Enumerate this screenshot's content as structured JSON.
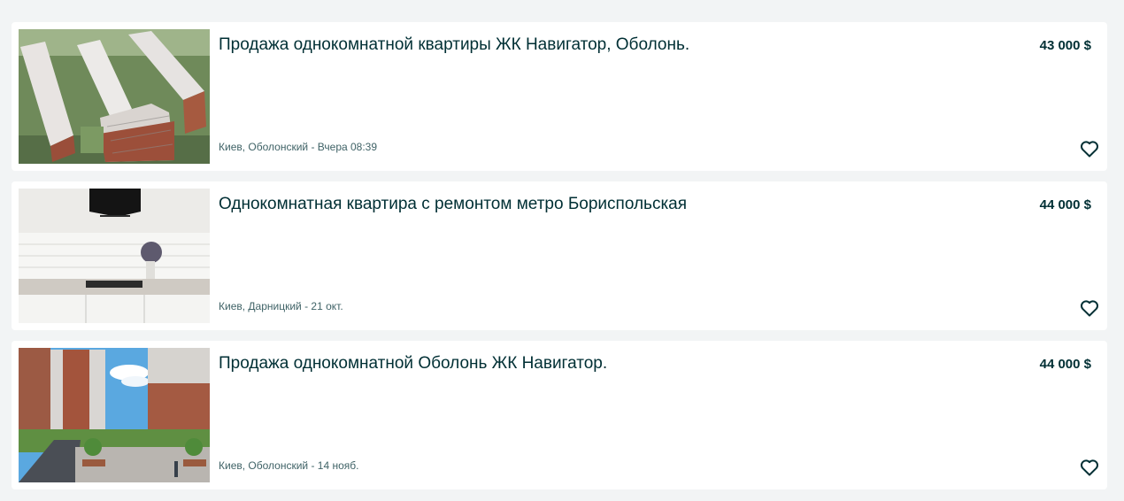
{
  "listings": [
    {
      "title": "Продажа однокомнатной квартиры ЖК Навигатор, Оболонь.",
      "price": "43 000 $",
      "location_date": "Киев, Оболонский - Вчера 08:39",
      "image": "building-complex-aerial-photo",
      "favorite_icon": "heart-outline-icon"
    },
    {
      "title": "Однокомнатная квартира с ремонтом метро Бориспольская",
      "price": "44 000 $",
      "location_date": "Киев, Дарницкий - 21 окт.",
      "image": "kitchen-interior-photo",
      "favorite_icon": "heart-outline-icon"
    },
    {
      "title": "Продажа однокомнатной Оболонь ЖК Навигатор.",
      "price": "44 000 $",
      "location_date": "Киев, Оболонский - 14 нояб.",
      "image": "residential-courtyard-photo",
      "favorite_icon": "heart-outline-icon"
    }
  ],
  "colors": {
    "page_background": "#f2f4f5",
    "card_background": "#ffffff",
    "text_primary": "#002f34",
    "text_secondary": "#406367"
  }
}
